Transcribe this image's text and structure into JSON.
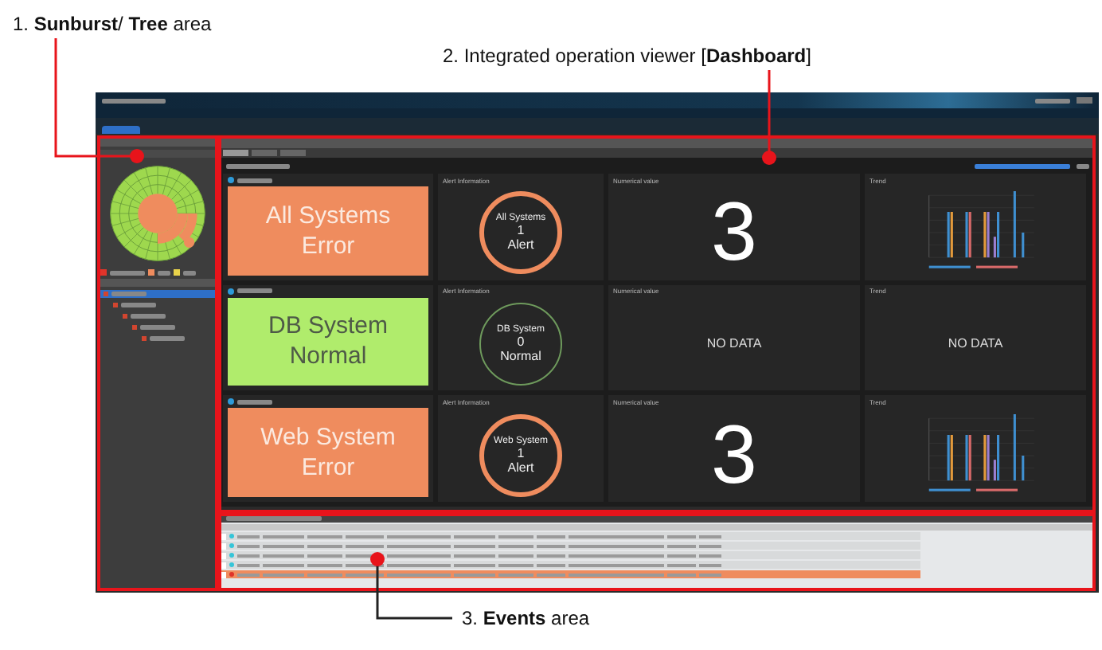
{
  "annotations": [
    {
      "text": "1. **Sunburst**/ **Tree** area"
    },
    {
      "text": "2. Integrated operation viewer [**Dashboard**]"
    },
    {
      "text": "3. **Events** area"
    }
  ],
  "sidebar": {
    "tree": [
      {
        "selected": true,
        "children": [
          {
            "selected": false,
            "children": [
              {
                "selected": false,
                "children": [
                  {
                    "selected": false,
                    "children": [
                      {
                        "selected": false
                      }
                    ]
                  }
                ]
              }
            ]
          }
        ]
      }
    ]
  },
  "dashboard": {
    "tabs": [
      {
        "selected": true
      },
      {
        "selected": false
      },
      {
        "selected": false
      }
    ],
    "rows": [
      {
        "status": {
          "kind": "error",
          "line1": "All Systems",
          "line2": "Error"
        },
        "alert": {
          "title": "Alert Information",
          "kind": "error",
          "lines": [
            "All Systems",
            "1",
            "Alert"
          ]
        },
        "numeric": {
          "title": "Numerical value",
          "kind": "value",
          "value": "3"
        },
        "trend": {
          "title": "Trend",
          "kind": "chart"
        }
      },
      {
        "status": {
          "kind": "normal",
          "line1": "DB System",
          "line2": "Normal"
        },
        "alert": {
          "title": "Alert Information",
          "kind": "normal",
          "lines": [
            "DB System",
            "0",
            "Normal"
          ]
        },
        "numeric": {
          "title": "Numerical value",
          "kind": "empty",
          "value": "NO DATA"
        },
        "trend": {
          "title": "Trend",
          "kind": "empty",
          "message": "NO DATA"
        }
      },
      {
        "status": {
          "kind": "error",
          "line1": "Web System",
          "line2": "Error"
        },
        "alert": {
          "title": "Alert Information",
          "kind": "error",
          "lines": [
            "Web System",
            "1",
            "Alert"
          ]
        },
        "numeric": {
          "title": "Numerical value",
          "kind": "value",
          "value": "3"
        },
        "trend": {
          "title": "Trend",
          "kind": "chart"
        }
      }
    ]
  },
  "events": {
    "rows": [
      {
        "color": "#35c5d8",
        "selected": false
      },
      {
        "color": "#35c5d8",
        "selected": false
      },
      {
        "color": "#35c5d8",
        "selected": false
      },
      {
        "color": "#35c5d8",
        "selected": false
      },
      {
        "color": "#e0342a",
        "selected": true
      }
    ]
  }
}
